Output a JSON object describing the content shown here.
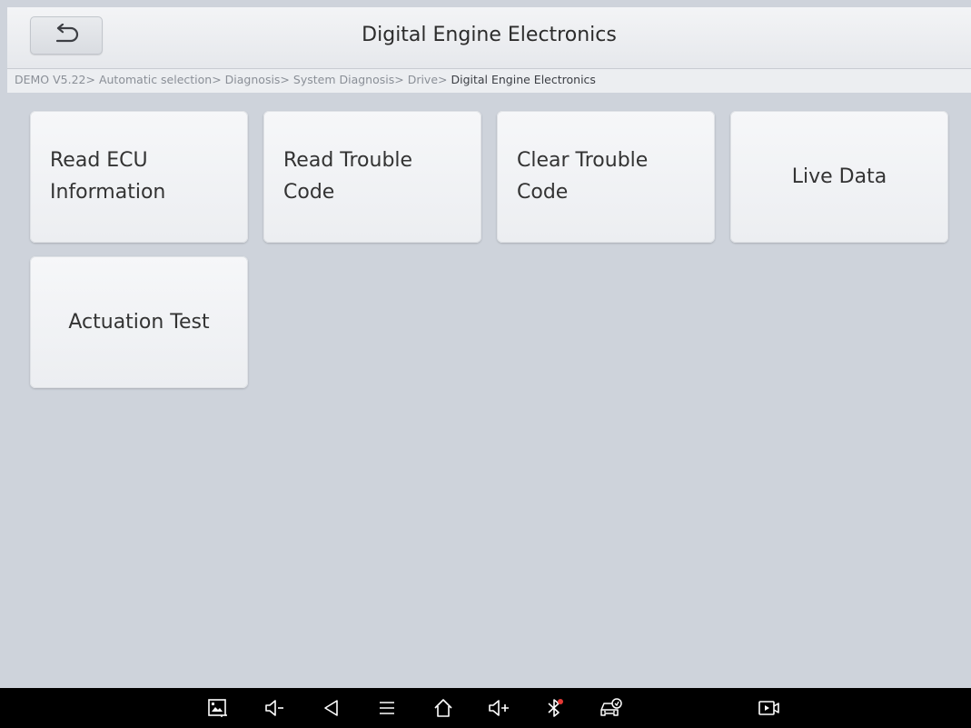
{
  "header": {
    "title": "Digital Engine Electronics"
  },
  "breadcrumb": {
    "items": [
      "DEMO V5.22>",
      " Automatic selection>",
      " Diagnosis>",
      " System Diagnosis>",
      " Drive>",
      " Digital Engine Electronics"
    ]
  },
  "menu": {
    "tiles": [
      {
        "line1": "Read ECU",
        "line2": "Information"
      },
      {
        "line1": "Read Trouble",
        "line2": "Code"
      },
      {
        "line1": "Clear Trouble",
        "line2": "Code"
      },
      {
        "label": "Live Data"
      },
      {
        "label": "Actuation Test"
      }
    ]
  },
  "navbar": {
    "icons": [
      "screenshot-icon",
      "volume-down-icon",
      "back-icon",
      "menu-icon",
      "home-icon",
      "volume-up-icon",
      "bluetooth-icon",
      "vehicle-diagnosis-icon",
      "screen-record-icon"
    ],
    "bluetooth_dot_color": "#e53935"
  }
}
